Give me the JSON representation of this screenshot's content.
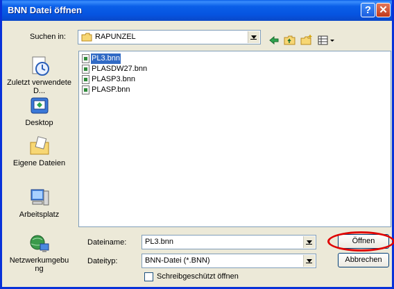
{
  "window": {
    "title": "BNN Datei öffnen",
    "help_label": "?",
    "close_label": "✕"
  },
  "lookin": {
    "label": "Suchen in:",
    "value": "RAPUNZEL"
  },
  "toolbar": {
    "icons": [
      "back-arrow-icon",
      "up-folder-icon",
      "new-folder-icon",
      "view-menu-icon"
    ]
  },
  "places": [
    {
      "label": "Zuletzt verwendete D...",
      "icon": "recent-clock-icon"
    },
    {
      "label": "Desktop",
      "icon": "desktop-icon"
    },
    {
      "label": "Eigene Dateien",
      "icon": "my-documents-icon"
    },
    {
      "label": "Arbeitsplatz",
      "icon": "my-computer-icon"
    },
    {
      "label": "Netzwerkumgebung",
      "icon": "network-icon"
    }
  ],
  "files": [
    {
      "name": "PL3.bnn",
      "selected": true
    },
    {
      "name": "PLASDW27.bnn",
      "selected": false
    },
    {
      "name": "PLASP3.bnn",
      "selected": false
    },
    {
      "name": "PLASP.bnn",
      "selected": false
    }
  ],
  "filename": {
    "label": "Dateiname:",
    "value": "PL3.bnn"
  },
  "filetype": {
    "label": "Dateityp:",
    "value": "BNN-Datei (*.BNN)"
  },
  "readonly": {
    "label": "Schreibgeschützt öffnen",
    "checked": false
  },
  "buttons": {
    "open": "Öffnen",
    "cancel": "Abbrechen"
  },
  "colors": {
    "titlebar": "#0a5fe8",
    "selection": "#316ac5",
    "annotation": "#e00000"
  }
}
